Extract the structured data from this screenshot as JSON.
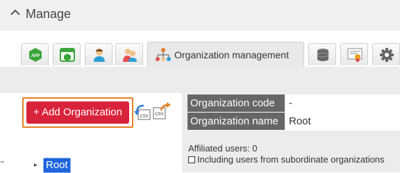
{
  "header": {
    "title": "Manage"
  },
  "tabs": {
    "active_label": "Organization management",
    "icons": [
      "app-icon",
      "app-window-icon",
      "user-icon",
      "users-group-icon",
      "organization-icon",
      "database-icon",
      "certificate-icon",
      "gear-icon"
    ]
  },
  "actions": {
    "add_organization_label": "+ Add Organization"
  },
  "details": {
    "code_label": "Organization code",
    "code_value": "-",
    "name_label": "Organization name",
    "name_value": "Root",
    "affiliated_users": "Affiliated users: 0",
    "include_subordinate_label": "Including users from subordinate organizations"
  },
  "tree": {
    "expand_glyph": "▸",
    "root_label": "Root"
  },
  "left_glyph": "⁼",
  "colors": {
    "accent_red": "#d9233b",
    "highlight_orange": "#e67e22",
    "selection_blue": "#1e64dc",
    "label_gray": "#666666"
  }
}
